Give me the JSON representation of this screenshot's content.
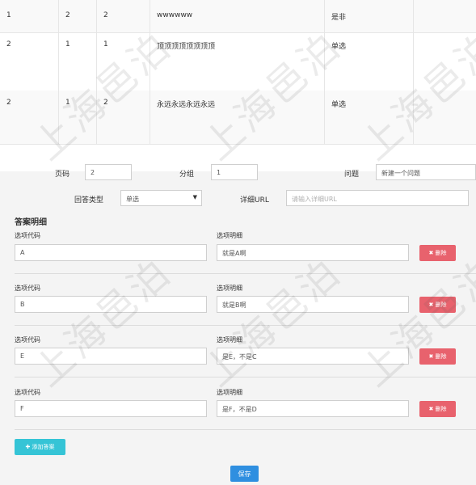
{
  "table": {
    "rows": [
      {
        "c0": "1",
        "c1": "2",
        "c2": "2",
        "c3": "wwwwww",
        "c4": "是非",
        "c5": ""
      },
      {
        "c0": "2",
        "c1": "1",
        "c2": "1",
        "c3": "顶顶顶顶顶顶顶顶",
        "c4": "单选",
        "c5": ""
      },
      {
        "c0": "2",
        "c1": "1",
        "c2": "2",
        "c3": "永远永远永远永远",
        "c4": "单选",
        "c5": ""
      }
    ]
  },
  "form": {
    "page_label": "页码",
    "page_value": "2",
    "group_label": "分组",
    "group_value": "1",
    "question_label": "问题",
    "question_value": "新建一个问题",
    "answer_type_label": "回答类型",
    "answer_type_value": "单选",
    "detail_url_label": "详细URL",
    "detail_url_placeholder": "请输入详细URL",
    "section_title": "答案明细",
    "option_code_label": "选项代码",
    "option_detail_label": "选项明细",
    "delete_label": "✖ 删除",
    "options": [
      {
        "code": "A",
        "detail": "就是A啊"
      },
      {
        "code": "B",
        "detail": "就是B啊"
      },
      {
        "code": "E",
        "detail": "是E，不是C"
      },
      {
        "code": "F",
        "detail": "是F，不是D"
      }
    ],
    "add_answer_label": "✚ 添加答案",
    "save_label": "保存"
  },
  "watermark": {
    "text": "上海邑泊"
  }
}
